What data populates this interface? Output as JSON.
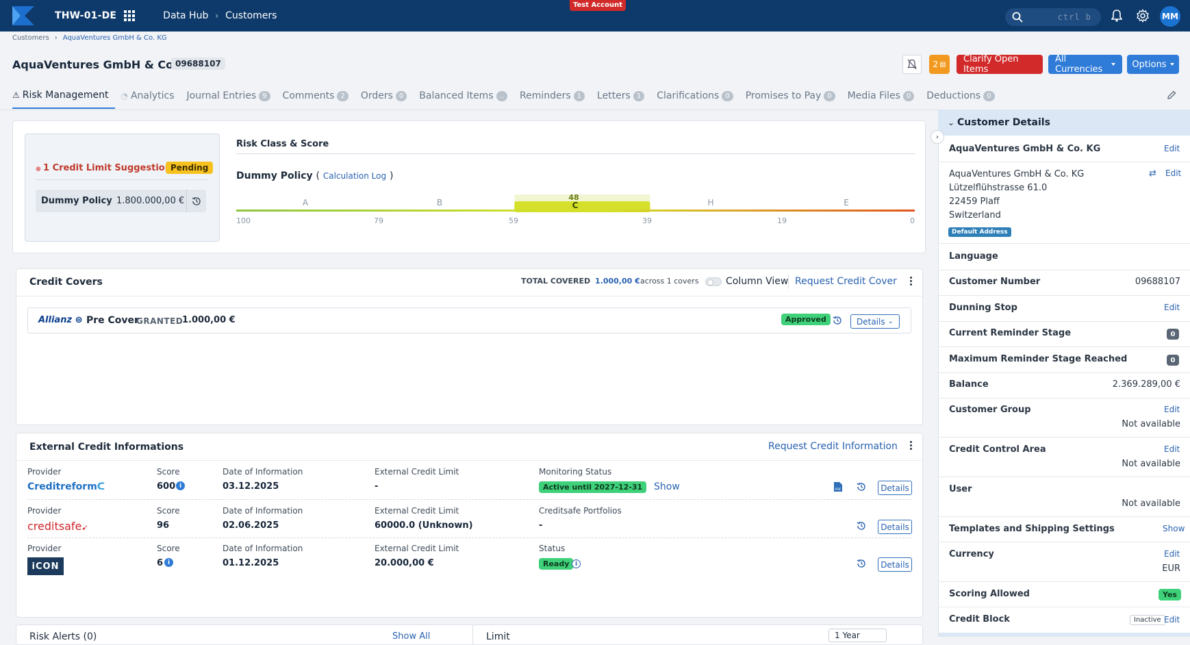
{
  "topbar": {
    "tenant": "THW-01-DE",
    "nav1": "Data Hub",
    "nav2": "Customers",
    "test_account": "Test Account",
    "search_kbd": "ctrl b",
    "avatar": "MM"
  },
  "breadcrumb": {
    "root": "Customers",
    "current": "AquaVentures GmbH & Co. KG"
  },
  "header": {
    "title": "AquaVentures GmbH & Co. KG",
    "id": "09688107",
    "orange_count": "2",
    "clarify_label": "Clarify Open Items",
    "currencies_label": "All Currencies",
    "options_label": "Options"
  },
  "tabs": [
    {
      "label": "Risk Management",
      "count": ""
    },
    {
      "label": "Analytics",
      "count": ""
    },
    {
      "label": "Journal Entries",
      "count": "9"
    },
    {
      "label": "Comments",
      "count": "2"
    },
    {
      "label": "Orders",
      "count": "0"
    },
    {
      "label": "Balanced Items",
      "count": ".."
    },
    {
      "label": "Reminders",
      "count": "1"
    },
    {
      "label": "Letters",
      "count": "1"
    },
    {
      "label": "Clarifications",
      "count": "0"
    },
    {
      "label": "Promises to Pay",
      "count": "0"
    },
    {
      "label": "Media Files",
      "count": "0"
    },
    {
      "label": "Deductions",
      "count": "0"
    }
  ],
  "risk": {
    "suggestion": "1 Credit Limit Suggestion",
    "pending": "Pending",
    "policy_label": "Dummy Policy",
    "policy_value": "1.800.000,00 €",
    "rcs_title": "Risk Class & Score",
    "policy_name": "Dummy Policy",
    "calc_log": "Calculation Log",
    "score": "48",
    "current_class": "C",
    "classes": [
      "A",
      "B",
      "C",
      "H",
      "E"
    ],
    "ticks": [
      "100",
      "79",
      "59",
      "39",
      "19",
      "0"
    ],
    "score_value": 48,
    "colors": {
      "low": "#8cc63f",
      "mid": "#d4e02a",
      "high": "#e2541e"
    }
  },
  "credit_covers": {
    "title": "Credit Covers",
    "total_label": "TOTAL COVERED",
    "total_value": "1.000,00 €",
    "across": "across 1 covers",
    "column_view": "Column View",
    "request": "Request Credit Cover",
    "cover": {
      "provider": "Allianz",
      "name": "Pre Cover",
      "status": "GRANTED",
      "amount": "1.000,00 €",
      "badge": "Approved",
      "details": "Details"
    }
  },
  "external": {
    "title": "External Credit Informations",
    "request": "Request Credit Information",
    "rows": [
      {
        "provider_label": "Provider",
        "provider": "Creditreform",
        "score_label": "Score",
        "score": "600",
        "date_label": "Date of Information",
        "date": "03.12.2025",
        "limit_label": "External Credit Limit",
        "limit": "-",
        "status_label": "Monitoring Status",
        "status": "Active until 2027-12-31",
        "status_link": "Show",
        "details": "Details"
      },
      {
        "provider_label": "Provider",
        "provider": "creditsafe",
        "score_label": "Score",
        "score": "96",
        "date_label": "Date of Information",
        "date": "02.06.2025",
        "limit_label": "External Credit Limit",
        "limit": "60000.0 (Unknown)",
        "status_label": "Creditsafe Portfolios",
        "status": "-",
        "details": "Details"
      },
      {
        "provider_label": "Provider",
        "provider": "iCON",
        "score_label": "Score",
        "score": "6",
        "date_label": "Date of Information",
        "date": "01.12.2025",
        "limit_label": "External Credit Limit",
        "limit": "20.000,00 €",
        "status_label": "Status",
        "status": "Ready",
        "details": "Details"
      }
    ]
  },
  "bottom": {
    "left_title": "Risk Alerts (0)",
    "left_link": "Show All",
    "right_title": "Limit",
    "right_select": "1 Year"
  },
  "sidebar": {
    "title": "Customer Details",
    "name": "AquaVentures GmbH & Co. KG",
    "edit": "Edit",
    "address": [
      "AquaVentures GmbH & Co. KG",
      "Lützelflühstrasse 61.0",
      "22459 Plaff",
      "Switzerland"
    ],
    "default_address": "Default Address",
    "language": "Language",
    "customer_number_label": "Customer Number",
    "customer_number": "09688107",
    "dunning_stop": "Dunning Stop",
    "reminder_stage": "Current Reminder Stage",
    "reminder_stage_val": "0",
    "max_reminder": "Maximum Reminder Stage Reached",
    "max_reminder_val": "0",
    "balance_label": "Balance",
    "balance": "2.369.289,00 €",
    "customer_group": "Customer Group",
    "not_available": "Not available",
    "credit_control": "Credit Control Area",
    "user": "User",
    "templates": "Templates and Shipping Settings",
    "show": "Show",
    "currency_label": "Currency",
    "currency": "EUR",
    "scoring_label": "Scoring Allowed",
    "scoring": "Yes",
    "credit_block": "Credit Block",
    "inactive": "Inactive"
  }
}
